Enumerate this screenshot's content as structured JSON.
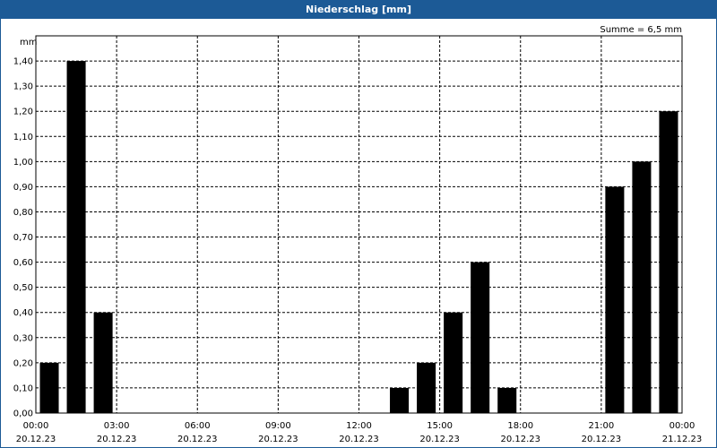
{
  "window": {
    "title": "Niederschlag [mm]"
  },
  "chart_data": {
    "type": "bar",
    "title": "Niederschlag [mm]",
    "ylabel": "mm",
    "annotation": "Summe = 6,5 mm",
    "ylim": [
      0,
      1.5
    ],
    "y_ticks": [
      "0,00",
      "0,10",
      "0,20",
      "0,30",
      "0,40",
      "0,50",
      "0,60",
      "0,70",
      "0,80",
      "0,90",
      "1,00",
      "1,10",
      "1,20",
      "1,30",
      "1,40"
    ],
    "x_ticks": [
      {
        "time": "00:00",
        "date": "20.12.23"
      },
      {
        "time": "03:00",
        "date": "20.12.23"
      },
      {
        "time": "06:00",
        "date": "20.12.23"
      },
      {
        "time": "09:00",
        "date": "20.12.23"
      },
      {
        "time": "12:00",
        "date": "20.12.23"
      },
      {
        "time": "15:00",
        "date": "20.12.23"
      },
      {
        "time": "18:00",
        "date": "20.12.23"
      },
      {
        "time": "21:00",
        "date": "20.12.23"
      },
      {
        "time": "00:00",
        "date": "21.12.23"
      }
    ],
    "bar_interval_hours": 1,
    "hours": [
      0,
      1,
      2,
      3,
      4,
      5,
      6,
      7,
      8,
      9,
      10,
      11,
      12,
      13,
      14,
      15,
      16,
      17,
      18,
      19,
      20,
      21,
      22,
      23
    ],
    "values": [
      0.2,
      1.4,
      0.4,
      0,
      0,
      0,
      0,
      0,
      0,
      0,
      0,
      0,
      0,
      0.1,
      0.2,
      0.4,
      0.6,
      0.1,
      0,
      0,
      0,
      0.9,
      1.0,
      1.2
    ],
    "bar_color": "#000000",
    "grid": true
  }
}
